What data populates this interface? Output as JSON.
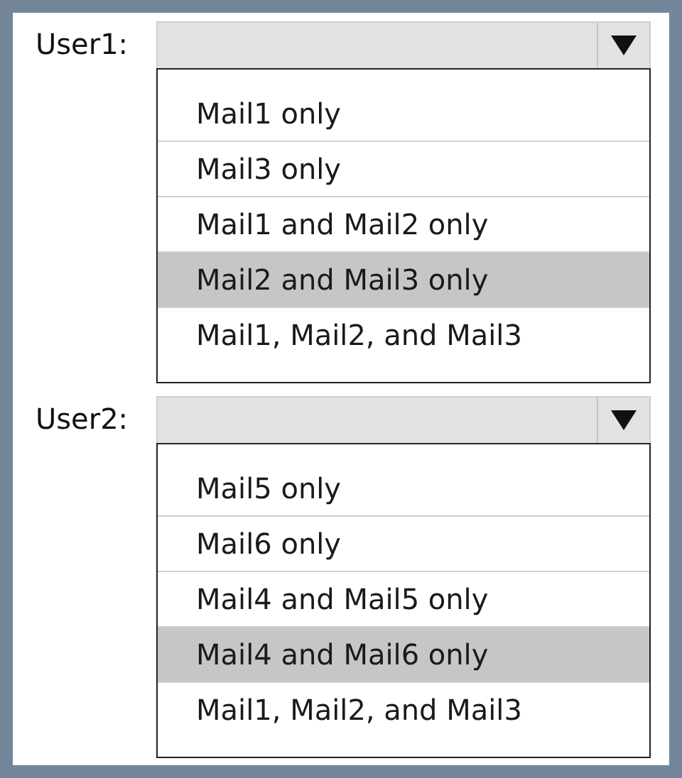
{
  "dropdowns": [
    {
      "label": "User1:",
      "options": [
        {
          "text": "Mail1 only",
          "selected": false
        },
        {
          "text": "Mail3 only",
          "selected": false
        },
        {
          "text": "Mail1 and Mail2 only",
          "selected": false
        },
        {
          "text": "Mail2 and Mail3 only",
          "selected": true
        },
        {
          "text": "Mail1, Mail2, and Mail3",
          "selected": false
        }
      ]
    },
    {
      "label": "User2:",
      "options": [
        {
          "text": "Mail5 only",
          "selected": false
        },
        {
          "text": "Mail6 only",
          "selected": false
        },
        {
          "text": "Mail4 and Mail5 only",
          "selected": false
        },
        {
          "text": "Mail4 and Mail6 only",
          "selected": true
        },
        {
          "text": "Mail1, Mail2, and Mail3",
          "selected": false
        }
      ]
    }
  ]
}
